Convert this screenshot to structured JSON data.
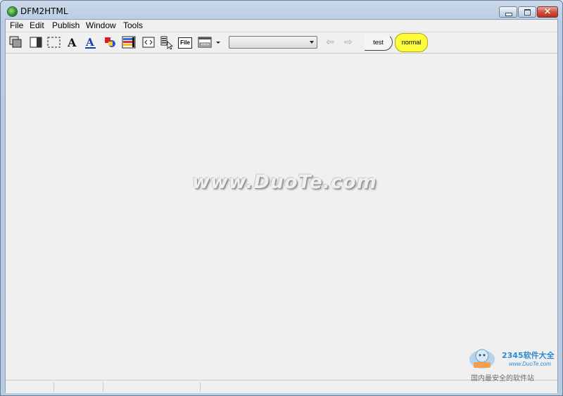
{
  "window": {
    "title": "DFM2HTML",
    "controls": {
      "minimize": "minimize",
      "maximize": "maximize",
      "close": "×"
    }
  },
  "menu": {
    "items": [
      "File",
      "Edit",
      "Publish",
      "Window",
      "Tools"
    ]
  },
  "toolbar": {
    "icons": [
      "layers-icon",
      "panel-icon",
      "selection-rect-icon",
      "font-icon",
      "underline-font-icon",
      "color-shapes-icon",
      "color-bars-icon",
      "embed-code-icon",
      "list-cursor-icon",
      "file-icon",
      "frame-icon"
    ],
    "file_label": "File",
    "dropdown_value": "",
    "nav_back": "⇦",
    "nav_forward": "⇨",
    "tabs": [
      {
        "label": "test",
        "color": "#f5f5f5"
      },
      {
        "label": "normal",
        "color": "#fdfd3d"
      }
    ]
  },
  "watermark": "www.DuoTe.com",
  "corner_watermark": {
    "brand": "2345软件大全",
    "site": "www.DuoTe.com",
    "slogan": "国内最安全的软件站"
  },
  "statusbar": {
    "panes": [
      "",
      "",
      "",
      ""
    ]
  }
}
